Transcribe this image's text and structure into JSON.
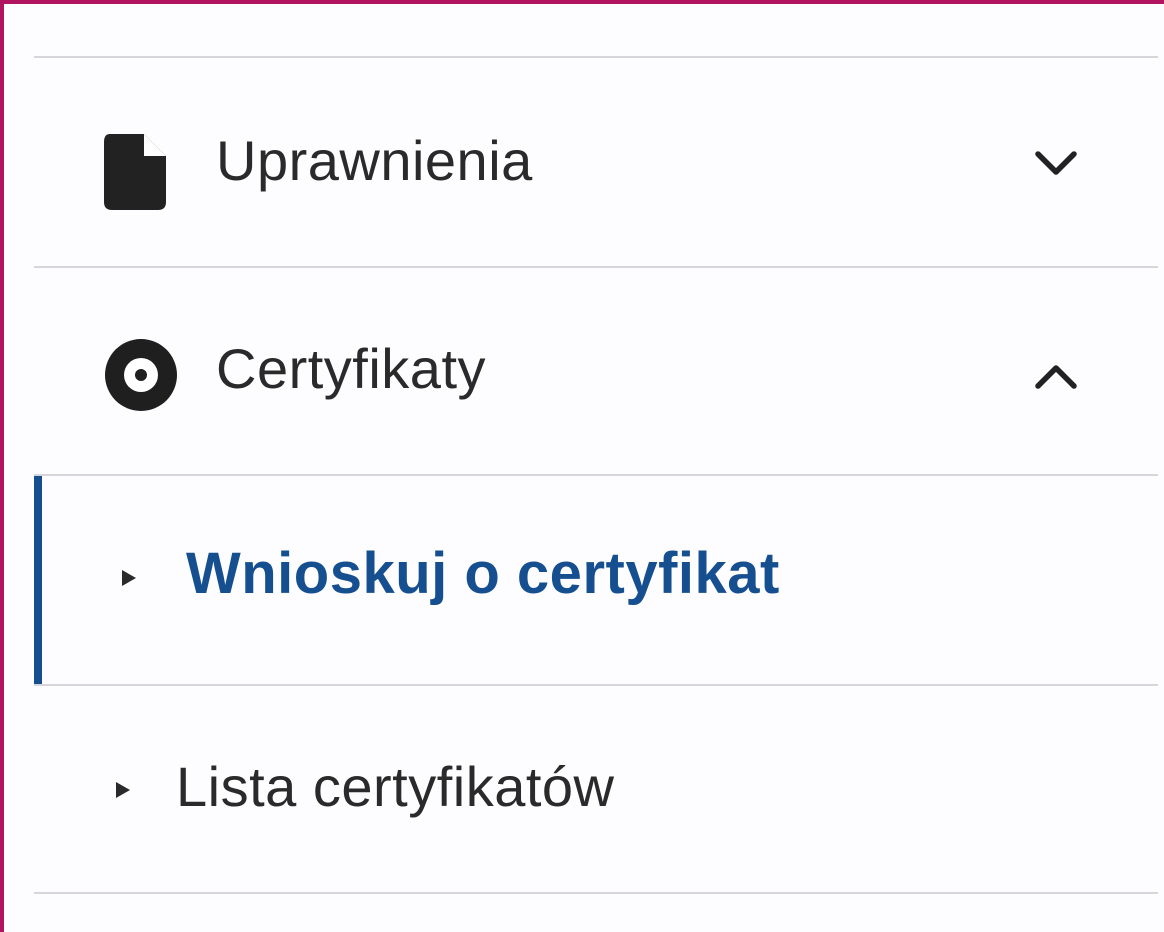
{
  "menu": {
    "sections": [
      {
        "label": "Uprawnienia",
        "icon": "document-icon",
        "state_icon": "chevron-down-icon"
      },
      {
        "label": "Certyfikaty",
        "icon": "record-icon",
        "state_icon": "chevron-up-icon"
      }
    ],
    "subitems": [
      {
        "label": "Wnioskuj o certyfikat",
        "icon": "triangle-right-icon",
        "active": true
      },
      {
        "label": "Lista certyfikatów",
        "icon": "triangle-right-icon",
        "active": false
      }
    ]
  },
  "colors": {
    "frame": "#b0145e",
    "active": "#164f8f",
    "text": "#2a2a2a",
    "divider": "#d7d7db"
  }
}
